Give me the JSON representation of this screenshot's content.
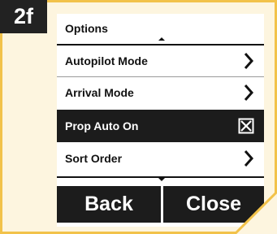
{
  "tag": "2f",
  "header": {
    "title": "Options"
  },
  "menu": {
    "items": [
      {
        "label": "Autopilot Mode",
        "control": "chevron-right-icon"
      },
      {
        "label": "Arrival Mode",
        "control": "chevron-right-icon"
      },
      {
        "label": "Prop Auto On",
        "control": "checkbox-checked-icon",
        "selected": true,
        "checked": true
      },
      {
        "label": "Sort Order",
        "control": "chevron-right-icon"
      }
    ]
  },
  "buttons": {
    "back": "Back",
    "close": "Close"
  },
  "colors": {
    "frame_border": "#f2c24a",
    "frame_bg": "#fdf5df",
    "tag_bg": "#222222",
    "selected_bg": "#1c1c1c",
    "button_bg": "#1c1c1c"
  }
}
